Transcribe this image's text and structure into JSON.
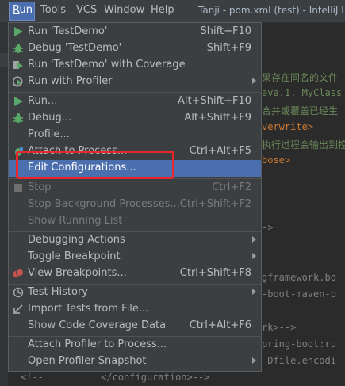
{
  "menubar": {
    "items": [
      {
        "label": "Run",
        "mnemonic_rest": "un",
        "mnemonic_first": "R"
      },
      {
        "label": "Tools"
      },
      {
        "label": "VCS"
      },
      {
        "label": "Window"
      },
      {
        "label": "Help"
      }
    ],
    "title": "Tanji - pom.xml (test) - IntelliJ ID"
  },
  "editor": {
    "lines": [
      "果存在同名的文件",
      "ava.1, MyClass",
      "合并或覆盖已经生",
      "verwrite>",
      "执行过程会输出到控",
      "bose>",
      "->",
      "gframework.bo",
      "-boot-maven-p",
      "rk>-->",
      "pring-boot:ru",
      "-Dfile.encodi"
    ],
    "bottom_line": "<!--          </configuration>-->"
  },
  "run_menu": {
    "items": [
      {
        "label": "Run 'TestDemo'",
        "shortcut": "Shift+F10",
        "icon": "run-icon"
      },
      {
        "label": "Debug 'TestDemo'",
        "shortcut": "Shift+F9",
        "icon": "debug-icon"
      },
      {
        "label": "Run 'TestDemo' with Coverage",
        "shortcut": "",
        "icon": "coverage-icon"
      },
      {
        "label": "Run with Profiler",
        "shortcut": "",
        "icon": "profiler-icon",
        "submenu": true
      },
      {
        "label": "Run...",
        "shortcut": "Alt+Shift+F10",
        "icon": "run-icon"
      },
      {
        "label": "Debug...",
        "shortcut": "Alt+Shift+F9",
        "icon": "debug-icon"
      },
      {
        "label": "Profile...",
        "shortcut": "",
        "icon": ""
      },
      {
        "label": "Attach to Process...",
        "shortcut": "Ctrl+Alt+F5",
        "icon": "attach-icon"
      },
      {
        "label": "Edit Configurations...",
        "shortcut": "",
        "icon": "",
        "selected": true
      },
      {
        "label": "Stop",
        "shortcut": "Ctrl+F2",
        "icon": "stop-icon",
        "disabled": true
      },
      {
        "label": "Stop Background Processes...",
        "shortcut": "Ctrl+Shift+F2",
        "disabled": true
      },
      {
        "label": "Show Running List",
        "shortcut": "",
        "disabled": true
      },
      {
        "label": "Debugging Actions",
        "submenu": true
      },
      {
        "label": "Toggle Breakpoint",
        "submenu": true
      },
      {
        "label": "View Breakpoints...",
        "shortcut": "Ctrl+Shift+F8",
        "icon": "breakpoints-icon"
      },
      {
        "label": "Test History",
        "icon": "history-icon",
        "submenu": true
      },
      {
        "label": "Import Tests from File...",
        "icon": "import-icon"
      },
      {
        "label": "Show Code Coverage Data",
        "shortcut": "Ctrl+Alt+F6"
      },
      {
        "label": "Attach Profiler to Process..."
      },
      {
        "label": "Open Profiler Snapshot",
        "submenu": true
      }
    ]
  },
  "colors": {
    "menubar_bg": "#3c3f41",
    "selection": "#4b6eaf",
    "highlight_box": "#e8262c",
    "run_green": "#59a869",
    "code_orange": "#cc7832",
    "code_green": "#6a8759"
  }
}
